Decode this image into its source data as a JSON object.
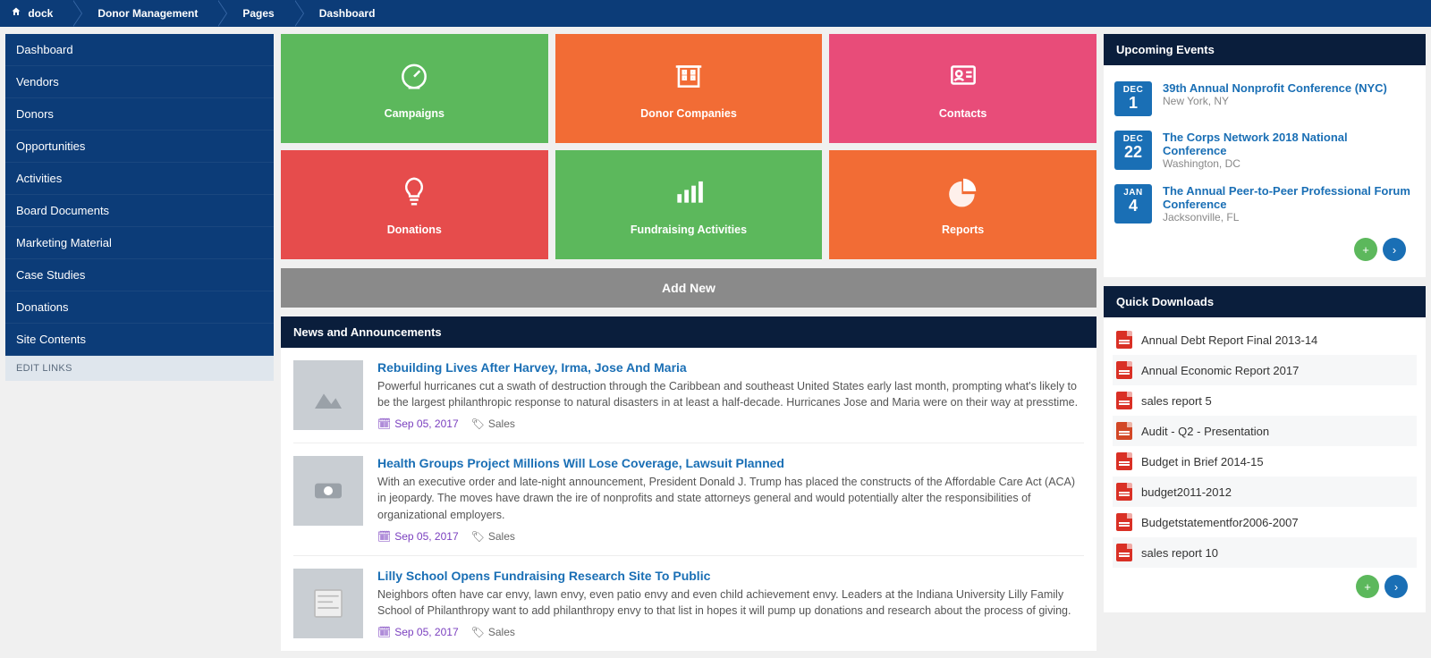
{
  "breadcrumb": {
    "home": "dock",
    "items": [
      "Donor Management",
      "Pages",
      "Dashboard"
    ]
  },
  "sidebar": {
    "items": [
      {
        "label": "Dashboard"
      },
      {
        "label": "Vendors"
      },
      {
        "label": "Donors"
      },
      {
        "label": "Opportunities"
      },
      {
        "label": "Activities"
      },
      {
        "label": "Board Documents"
      },
      {
        "label": "Marketing Material"
      },
      {
        "label": "Case Studies"
      },
      {
        "label": "Donations"
      },
      {
        "label": "Site Contents"
      }
    ],
    "edit_links": "EDIT LINKS"
  },
  "tiles": [
    {
      "label": "Campaigns",
      "color": "green",
      "icon": "gauge"
    },
    {
      "label": "Donor Companies",
      "color": "orange",
      "icon": "building"
    },
    {
      "label": "Contacts",
      "color": "pink",
      "icon": "id"
    },
    {
      "label": "Donations",
      "color": "red",
      "icon": "bulb"
    },
    {
      "label": "Fundraising Activities",
      "color": "green",
      "icon": "bars"
    },
    {
      "label": "Reports",
      "color": "orange",
      "icon": "pie"
    }
  ],
  "add_new": "Add New",
  "news": {
    "heading": "News and Announcements",
    "items": [
      {
        "title": "Rebuilding Lives After Harvey, Irma, Jose And Maria",
        "excerpt": "Powerful hurricanes cut a swath of destruction through the Caribbean and southeast United States early last month, prompting what's likely to be the largest philanthropic response to natural disasters in at least a half-decade. Hurricanes Jose and Maria were on their way at presstime.",
        "date": "Sep 05, 2017",
        "tag": "Sales"
      },
      {
        "title": "Health Groups Project Millions Will Lose Coverage, Lawsuit Planned",
        "excerpt": "With an executive order and late-night announcement, President Donald J. Trump has placed the constructs of the Affordable Care Act (ACA) in jeopardy. The moves have drawn the ire of nonprofits and state attorneys general and would potentially alter the responsibilities of organizational employers.",
        "date": "Sep 05, 2017",
        "tag": "Sales"
      },
      {
        "title": "Lilly School Opens Fundraising Research Site To Public",
        "excerpt": "Neighbors often have car envy, lawn envy, even patio envy and even child achievement envy. Leaders at the Indiana University Lilly Family School of Philanthropy want to add philanthropy envy to that list in hopes it will pump up donations and research about the process of giving.",
        "date": "Sep 05, 2017",
        "tag": "Sales"
      }
    ]
  },
  "events": {
    "heading": "Upcoming Events",
    "items": [
      {
        "month": "DEC",
        "day": "1",
        "title": "39th Annual Nonprofit Conference (NYC)",
        "location": "New York, NY"
      },
      {
        "month": "DEC",
        "day": "22",
        "title": "The Corps Network 2018 National Conference",
        "location": "Washington, DC"
      },
      {
        "month": "JAN",
        "day": "4",
        "title": "The Annual Peer-to-Peer Professional Forum Conference",
        "location": "Jacksonville, FL"
      }
    ]
  },
  "downloads": {
    "heading": "Quick Downloads",
    "items": [
      {
        "type": "pdf",
        "name": "Annual Debt Report Final 2013-14"
      },
      {
        "type": "pdf",
        "name": "Annual Economic Report 2017"
      },
      {
        "type": "pdf",
        "name": "sales report 5"
      },
      {
        "type": "ppt",
        "name": "Audit - Q2 - Presentation"
      },
      {
        "type": "pdf",
        "name": "Budget in Brief 2014-15"
      },
      {
        "type": "pdf",
        "name": "budget2011-2012"
      },
      {
        "type": "pdf",
        "name": "Budgetstatementfor2006-2007"
      },
      {
        "type": "pdf",
        "name": "sales report 10"
      }
    ]
  }
}
